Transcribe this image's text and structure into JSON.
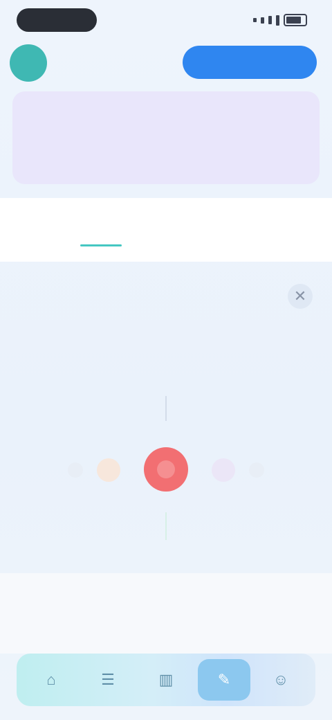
{
  "status_bar": {
    "time": ""
  },
  "header": {
    "avatar_initials": "",
    "brand": "",
    "cta_label": ""
  },
  "hero": {
    "title": "",
    "subtitle": ""
  },
  "tabs": [
    {
      "label": "",
      "active": true
    },
    {
      "label": "",
      "active": false
    }
  ],
  "question": {
    "close_icon": "close-icon",
    "text": "",
    "scale_top": "",
    "scale_bottom": "",
    "options": [
      {
        "selected": false,
        "color": "#e8eef6"
      },
      {
        "selected": false,
        "color": "#f7e7dc"
      },
      {
        "selected": true,
        "color": "#f26f72"
      },
      {
        "selected": false,
        "color": "#ebe6f7"
      },
      {
        "selected": false,
        "color": "#e8eef6"
      }
    ]
  },
  "info": {
    "text": ""
  },
  "bottom_nav": {
    "items": [
      {
        "icon": "home-icon",
        "label": ""
      },
      {
        "icon": "list-icon",
        "label": ""
      },
      {
        "icon": "chart-icon",
        "label": ""
      },
      {
        "icon": "test-icon",
        "label": "",
        "active": true
      },
      {
        "icon": "profile-icon",
        "label": ""
      }
    ]
  },
  "colors": {
    "accent_teal": "#45c7c2",
    "primary_blue": "#2f86f0",
    "selected_red": "#f26f72",
    "hero_bg": "#e9e6fb"
  }
}
